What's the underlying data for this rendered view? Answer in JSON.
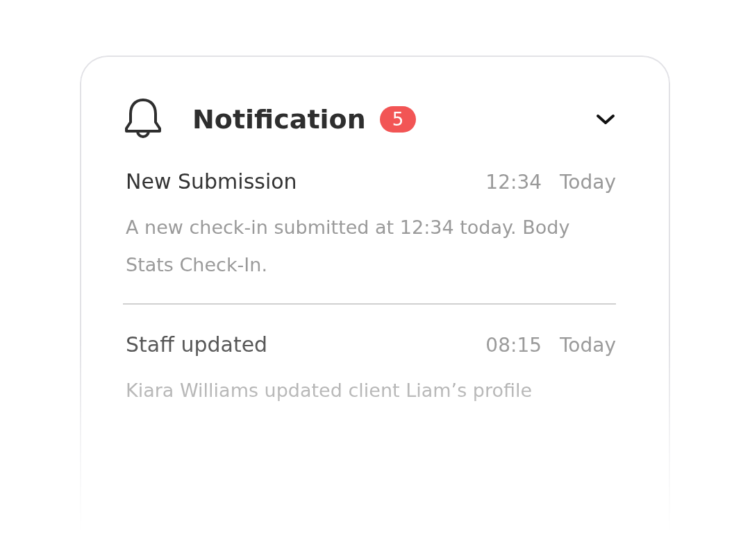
{
  "header": {
    "title": "Notification",
    "badge": "5",
    "expanded": true
  },
  "notifications": [
    {
      "title": "New Submission",
      "time": "12:34",
      "day": "Today",
      "body": "A new check-in submitted at 12:34 today.  Body Stats Check-In."
    },
    {
      "title": "Staff updated",
      "time": "08:15",
      "day": "Today",
      "body": "Kiara Williams updated client Liam’s profile"
    }
  ]
}
